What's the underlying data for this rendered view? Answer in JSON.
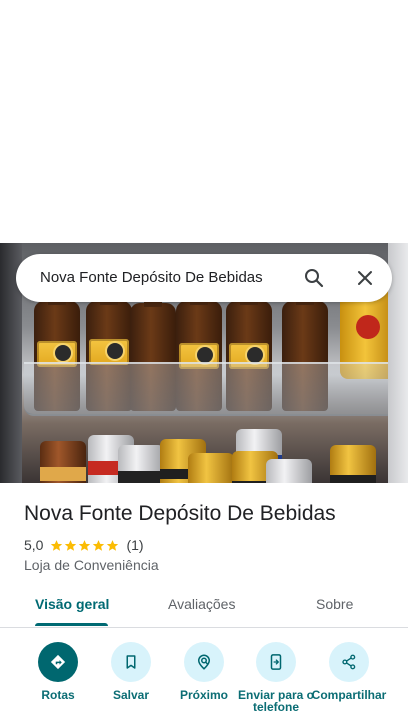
{
  "search": {
    "query": "Nova Fonte Depósito De Bebidas"
  },
  "place": {
    "name": "Nova Fonte Depósito De Bebidas",
    "rating": "5,0",
    "stars": 5,
    "review_count": "(1)",
    "category": "Loja de Conveniência"
  },
  "tabs": [
    {
      "label": "Visão geral",
      "active": true
    },
    {
      "label": "Avaliações",
      "active": false
    },
    {
      "label": "Sobre",
      "active": false
    }
  ],
  "actions": [
    {
      "label": "Rotas",
      "icon": "directions-icon"
    },
    {
      "label": "Salvar",
      "icon": "bookmark-icon"
    },
    {
      "label": "Próximo",
      "icon": "nearby-icon"
    },
    {
      "label": "Enviar para o telefone",
      "icon": "send-to-phone-icon"
    },
    {
      "label": "Compartilhar",
      "icon": "share-icon"
    }
  ],
  "colors": {
    "accent": "#00676f",
    "action_bg": "#d8f3fb",
    "star": "#fbbc04"
  }
}
